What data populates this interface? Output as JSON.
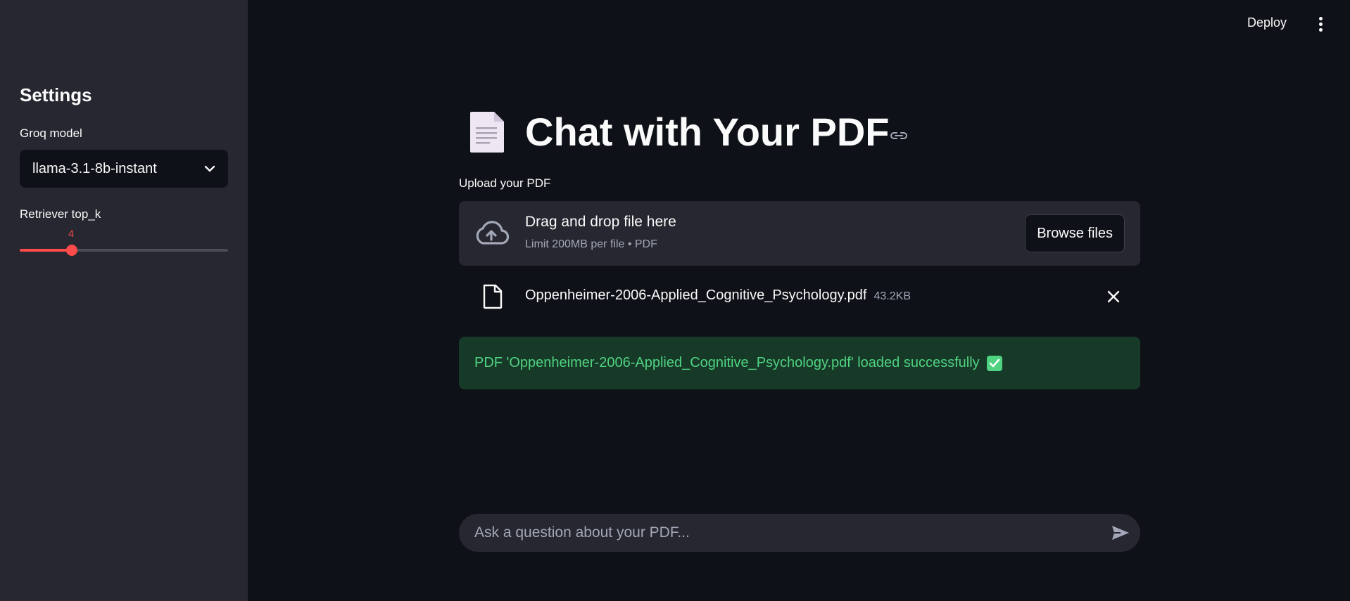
{
  "topbar": {
    "deploy_label": "Deploy",
    "menu_icon": "vertical-ellipsis-icon"
  },
  "sidebar": {
    "title": "Settings",
    "model_label": "Groq model",
    "model_value": "llama-3.1-8b-instant",
    "topk_label": "Retriever top_k",
    "topk_value": "4",
    "topk_fraction": 0.25
  },
  "main": {
    "title_icon": "page-document-icon",
    "title": "Chat with Your PDF",
    "upload_label": "Upload your PDF",
    "dropzone": {
      "title": "Drag and drop file here",
      "subtitle": "Limit 200MB per file • PDF",
      "browse_label": "Browse files"
    },
    "file": {
      "name": "Oppenheimer-2006-Applied_Cognitive_Psychology.pdf",
      "size": "43.2KB"
    },
    "success_message": "PDF 'Oppenheimer-2006-Applied_Cognitive_Psychology.pdf' loaded successfully",
    "chat": {
      "placeholder": "Ask a question about your PDF..."
    }
  },
  "colors": {
    "accent": "#ff4b4b",
    "success_text": "#4fd381",
    "success_bg": "#173928",
    "background": "#0e1117",
    "sidebar_bg": "#262730"
  }
}
